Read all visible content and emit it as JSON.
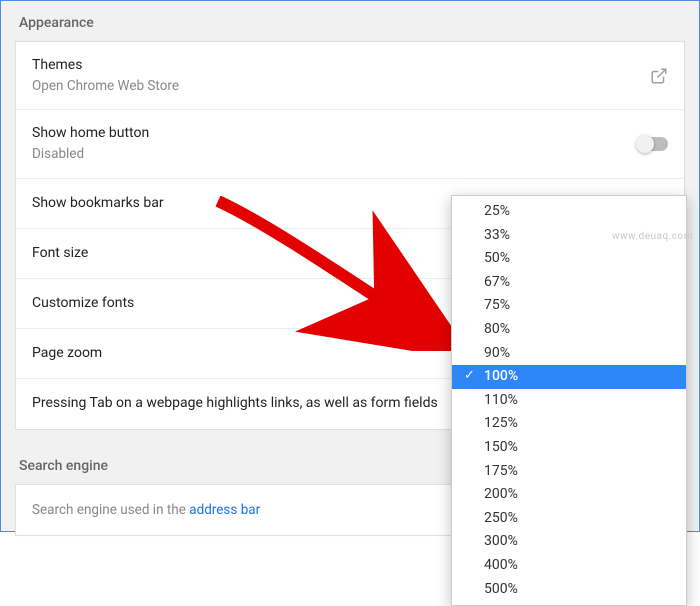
{
  "sections": {
    "appearance_header": "Appearance",
    "search_header": "Search engine"
  },
  "appearance": {
    "themes": {
      "title": "Themes",
      "sub": "Open Chrome Web Store"
    },
    "home_button": {
      "title": "Show home button",
      "sub": "Disabled",
      "enabled": false
    },
    "bookmarks": {
      "title": "Show bookmarks bar",
      "enabled": false
    },
    "font_size": {
      "title": "Font size"
    },
    "customize_fonts": {
      "title": "Customize fonts"
    },
    "page_zoom": {
      "title": "Page zoom"
    },
    "tab_highlight": {
      "title": "Pressing Tab on a webpage highlights links, as well as form fields"
    }
  },
  "search": {
    "row_prefix": "Search engine used in the ",
    "row_link": "address bar"
  },
  "zoom_dropdown": {
    "selected": "100%",
    "options": [
      "25%",
      "33%",
      "50%",
      "67%",
      "75%",
      "80%",
      "90%",
      "100%",
      "110%",
      "125%",
      "150%",
      "175%",
      "200%",
      "250%",
      "300%",
      "400%",
      "500%"
    ]
  },
  "watermark": "www.deuaq.com"
}
